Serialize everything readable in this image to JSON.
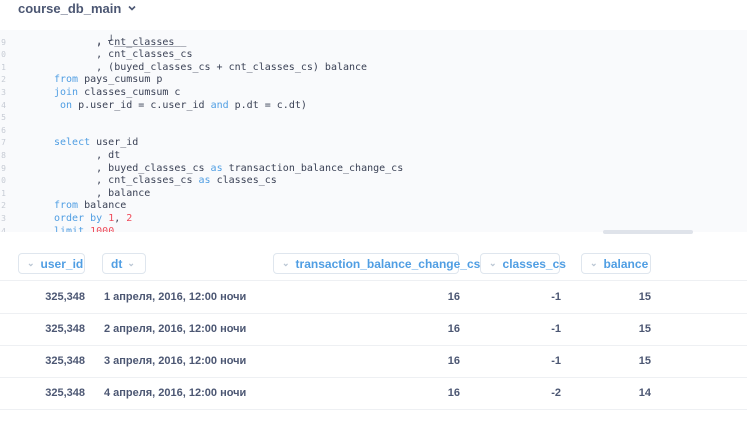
{
  "header": {
    "db_name": "course_db_main"
  },
  "editor": {
    "lines": [
      {
        "ln": "",
        "text": ""
      },
      {
        "ln": "9",
        "text": "       , cnt_classes"
      },
      {
        "ln": "0",
        "text": "       , cnt_classes_cs"
      },
      {
        "ln": "1",
        "text": "       , (buyed_classes_cs + cnt_classes_cs) balance"
      },
      {
        "ln": "2",
        "text": "from pays_cumsum p"
      },
      {
        "ln": "3",
        "text": "join classes_cumsum c"
      },
      {
        "ln": "4",
        "text": " on p.user_id = c.user_id and p.dt = c.dt)"
      },
      {
        "ln": "5",
        "text": ""
      },
      {
        "ln": "6",
        "text": ""
      },
      {
        "ln": "7",
        "text": "select user_id"
      },
      {
        "ln": "8",
        "text": "       , dt"
      },
      {
        "ln": "9",
        "text": "       , buyed_classes_cs as transaction_balance_change_cs"
      },
      {
        "ln": "0",
        "text": "       , cnt_classes_cs as classes_cs"
      },
      {
        "ln": "1",
        "text": "       , balance"
      },
      {
        "ln": "2",
        "text": "from balance"
      },
      {
        "ln": "3",
        "text": "order by 1, 2"
      },
      {
        "ln": "4",
        "text": "limit 1000"
      }
    ]
  },
  "table": {
    "columns": [
      "user_id",
      "dt",
      "transaction_balance_change_cs",
      "classes_cs",
      "balance"
    ],
    "rows": [
      [
        "325,348",
        "1 апреля, 2016, 12:00 ночи",
        "16",
        "-1",
        "15"
      ],
      [
        "325,348",
        "2 апреля, 2016, 12:00 ночи",
        "16",
        "-1",
        "15"
      ],
      [
        "325,348",
        "3 апреля, 2016, 12:00 ночи",
        "16",
        "-1",
        "15"
      ],
      [
        "325,348",
        "4 апреля, 2016, 12:00 ночи",
        "16",
        "-2",
        "14"
      ]
    ]
  }
}
